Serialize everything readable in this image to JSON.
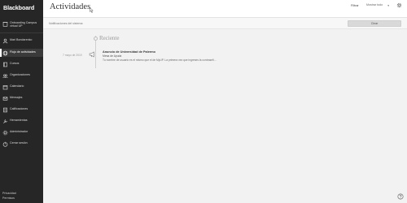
{
  "sidebar": {
    "brand": "Blackboard",
    "items": [
      {
        "label": "Onboarding Campus virtual UP",
        "icon": "building-icon"
      },
      {
        "label": "Mari Bondarenko",
        "icon": "user-icon"
      },
      {
        "label": "Flujo de actividades",
        "icon": "globe-icon"
      },
      {
        "label": "Cursos",
        "icon": "book-icon"
      },
      {
        "label": "Organizaciones",
        "icon": "people-icon"
      },
      {
        "label": "Calendario",
        "icon": "calendar-icon"
      },
      {
        "label": "Mensajes",
        "icon": "envelope-icon"
      },
      {
        "label": "Calificaciones",
        "icon": "grades-icon"
      },
      {
        "label": "Herramientas",
        "icon": "tools-icon"
      },
      {
        "label": "Administrador",
        "icon": "admin-icon"
      },
      {
        "label": "Cerrar sesión",
        "icon": "logout-icon"
      }
    ],
    "footer": [
      "Privacidad",
      "Permisos"
    ]
  },
  "header": {
    "title": "Actividades",
    "filter_label": "Filtrar",
    "filter_value": "Mostrar todo"
  },
  "notifications": {
    "text": "Notificaciones del sistema",
    "clear_label": "Clear"
  },
  "main": {
    "section_title": "Reciente",
    "item": {
      "date": "7 mayo de 2019",
      "title": "Anuncio de Universidad de Palermo",
      "subtitle": "Mesa de Ayuda",
      "body": "Tu nombre de usuario es el mismo que el de MyUP. La primera vez que ingreses la contraseñ..."
    }
  },
  "colors": {
    "sidebar_bg": "#262626",
    "header_bg": "#ffffff",
    "main_bg": "#f2f2f2",
    "button_bg": "#d9d9d9"
  }
}
